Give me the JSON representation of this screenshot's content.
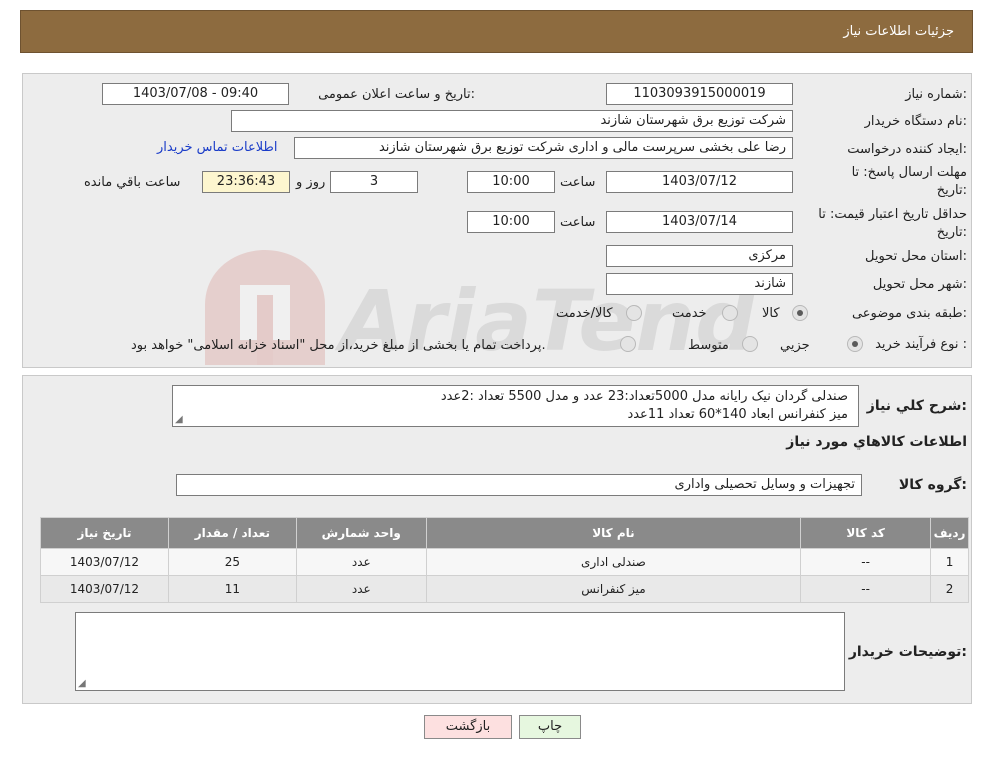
{
  "header": {
    "title": "جزئیات اطلاعات نیاز"
  },
  "form": {
    "need_number_label": "شماره نیاز:",
    "need_number": "1103093915000019",
    "announce_label": "تاریخ و ساعت اعلان عمومی:",
    "announce_value": "1403/07/08 - 09:40",
    "buyer_org_label": "نام دستگاه خریدار:",
    "buyer_org": "شرکت توزیع برق شهرستان شازند",
    "creator_label": "ایجاد کننده درخواست:",
    "creator": "رضا علی بخشی سرپرست مالی و اداری شرکت توزیع برق شهرستان شازند",
    "contact_link": "اطلاعات تماس خریدار",
    "reply_deadline_label_1": "مهلت ارسال پاسخ: تا",
    "reply_deadline_label_2": "تاریخ:",
    "reply_date": "1403/07/12",
    "time_label": "ساعت",
    "reply_time": "10:00",
    "days_value": "3",
    "days_label": "روز و",
    "remaining_time": "23:36:43",
    "remaining_label": "ساعت باقي مانده",
    "price_validity_label_1": "حداقل تاریخ اعتبار قیمت: تا",
    "price_validity_label_2": "تاریخ:",
    "price_date": "1403/07/14",
    "price_time": "10:00",
    "province_label": "استان محل تحویل:",
    "province": "مرکزی",
    "city_label": "شهر محل تحویل:",
    "city": "شازند",
    "category_label": "طبقه بندی موضوعی:",
    "category_options": [
      "کالا",
      "خدمت",
      "کالا/خدمت"
    ],
    "category_selected": 0,
    "process_label": "نوع فرآیند خرید :",
    "process_options": [
      "جزیي",
      "متوسط"
    ],
    "process_selected": 0,
    "process_note": "پرداخت تمام یا بخشی از مبلغ خرید،از محل \"اسناد خزانه اسلامی\" خواهد بود."
  },
  "description": {
    "label": "شرح کلي نياز:",
    "line1": "صندلی گردان نیک رایانه مدل 5000تعداد:23 عدد و مدل 5500 تعداد :2عدد",
    "line2": "میز کنفرانس ابعاد 140*60  تعداد 11عدد"
  },
  "goods_section_title": "اطلاعات کالاهاي مورد نياز",
  "goods_group_label": "گروه کالا:",
  "goods_group": "تجهیزات و وسایل تحصیلی واداری",
  "table": {
    "headers": [
      "ردیف",
      "کد کالا",
      "نام کالا",
      "واحد شمارش",
      "تعداد / مقدار",
      "تاریخ نیاز"
    ],
    "rows": [
      [
        "1",
        "--",
        "صندلی اداری",
        "عدد",
        "25",
        "1403/07/12"
      ],
      [
        "2",
        "--",
        "میز کنفرانس",
        "عدد",
        "11",
        "1403/07/12"
      ]
    ]
  },
  "buyer_notes_label": "توضیحات خریدار:",
  "buttons": {
    "print": "چاپ",
    "back": "بازگشت"
  },
  "watermark_text": "AriaTender.neT",
  "colors": {
    "header": "#8d6b3f",
    "table_header": "#8a8a8a",
    "back_button": "#fde0e0",
    "print_button": "#e6f7df"
  }
}
